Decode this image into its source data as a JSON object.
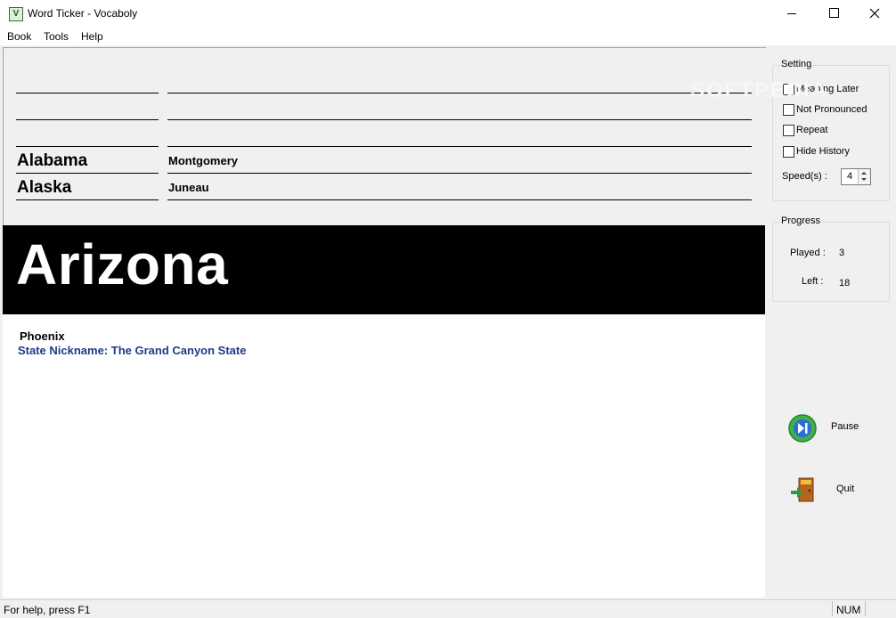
{
  "window": {
    "title": "Word Ticker - Vocaboly",
    "icon": "vocaboly-app-icon"
  },
  "menu": [
    "Book",
    "Tools",
    "Help"
  ],
  "word_rows": [
    {
      "word": "",
      "meaning": ""
    },
    {
      "word": "",
      "meaning": ""
    },
    {
      "word": "",
      "meaning": ""
    },
    {
      "word": "Alabama",
      "meaning": "Montgomery"
    },
    {
      "word": "Alaska",
      "meaning": "Juneau"
    }
  ],
  "current": {
    "word": "Arizona",
    "meaning": "Phoenix",
    "detail": "State Nickname: The Grand Canyon State"
  },
  "setting": {
    "title": "Setting",
    "options": [
      {
        "label": "Meaning Later",
        "checked": false
      },
      {
        "label": "Not Pronounced",
        "checked": false
      },
      {
        "label": "Repeat",
        "checked": false
      },
      {
        "label": "Hide History",
        "checked": false
      }
    ],
    "speed_label": "Speed(s) :",
    "speed_value": "4"
  },
  "progress": {
    "title": "Progress",
    "played_label": "Played :",
    "played_value": "3",
    "left_label": "Left :",
    "left_value": "18"
  },
  "actions": {
    "pause_label": "Pause",
    "pause_icon": "pause-icon",
    "quit_label": "Quit",
    "quit_icon": "exit-door-icon"
  },
  "status": {
    "help_text": "For help, press F1",
    "num": "NUM"
  },
  "watermark": "SOFTPEDIA",
  "colors": {
    "banner_bg": "#000000",
    "banner_text": "#ffffff",
    "detail_text": "#1f3a8a"
  }
}
